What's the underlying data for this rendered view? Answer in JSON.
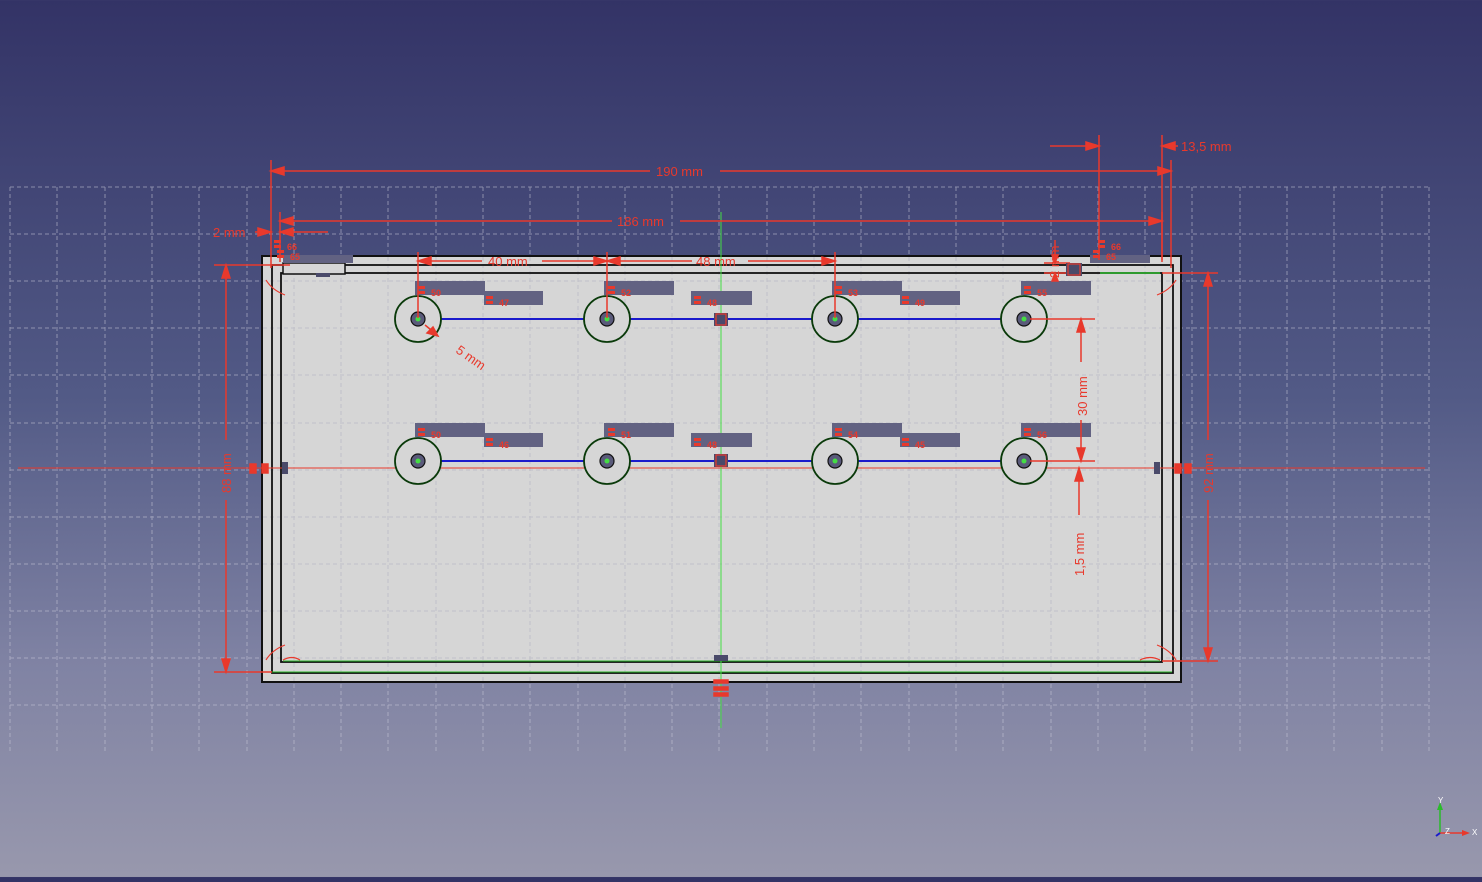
{
  "dimensions": {
    "overall_width": "190 mm",
    "inner_width": "186 mm",
    "offset_right": "13,5 mm",
    "wall": "2 mm",
    "pitch_1": "40 mm",
    "pitch_2": "48 mm",
    "radius": "5 mm",
    "row_spacing": "30 mm",
    "center_offset": "1,5 mm",
    "inner_height": "88 mm",
    "overall_height": "92 mm",
    "small_gap": "2 mm"
  },
  "constraint_ids": {
    "top_left_a": "66",
    "top_left_b": "65",
    "top_right_a": "66",
    "top_right_b": "65",
    "hole_top_1": "50",
    "hole_top_2": "52",
    "hole_top_3": "53",
    "hole_top_4": "55",
    "hole_bot_1": "50",
    "hole_bot_2": "51",
    "hole_bot_3": "54",
    "hole_bot_4": "56",
    "line_top_1": "47",
    "line_top_2": "48",
    "line_top_3": "49",
    "line_bot_1": "46",
    "line_bot_2": "48",
    "line_bot_3": "45"
  },
  "axis_cross": {
    "x_label": "X",
    "y_label": "Y",
    "z_label": "Z"
  },
  "colors": {
    "dimension": "#e8392c",
    "geometry_circle": "#0a3a0a",
    "construction_line": "#1a1acc",
    "sketch_axis_v": "#44dd44",
    "sketch_axis_h": "#e8392c",
    "plate_fill": "#d6d6d6",
    "grid": "#c8c8d8"
  }
}
